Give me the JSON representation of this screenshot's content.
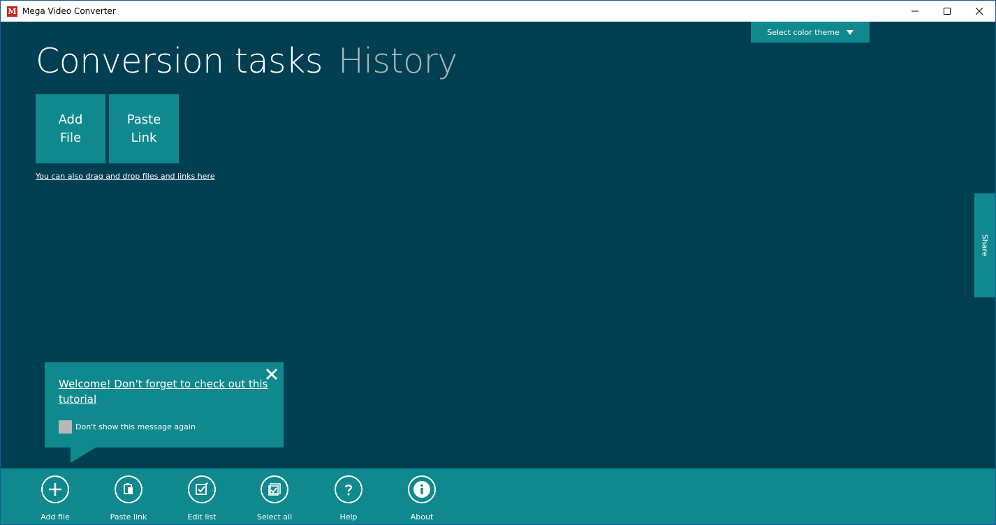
{
  "window": {
    "title": "Mega Video Converter",
    "icon_letter": "M"
  },
  "header": {
    "theme_button": "Select color theme",
    "tab_active": "Conversion tasks",
    "tab_inactive": "History"
  },
  "tiles": {
    "add_line1": "Add",
    "add_line2": "File",
    "paste_line1": "Paste",
    "paste_line2": "Link"
  },
  "drag_hint": "You can also drag and drop files and links here",
  "share_label": "Share",
  "popup": {
    "message": "Welcome! Don't forget to check out this tutorial",
    "checkbox_label": "Don't show this message again"
  },
  "toolbar": {
    "items": [
      {
        "label": "Add file",
        "icon": "plus-icon"
      },
      {
        "label": "Paste link",
        "icon": "clipboard-icon"
      },
      {
        "label": "Edit list",
        "icon": "edit-list-icon"
      },
      {
        "label": "Select all",
        "icon": "select-all-icon"
      },
      {
        "label": "Help",
        "icon": "question-icon"
      },
      {
        "label": "About",
        "icon": "info-icon"
      }
    ]
  },
  "colors": {
    "background": "#003f52",
    "accent": "#0f898d",
    "inactive_tab": "#a9b6bb"
  }
}
